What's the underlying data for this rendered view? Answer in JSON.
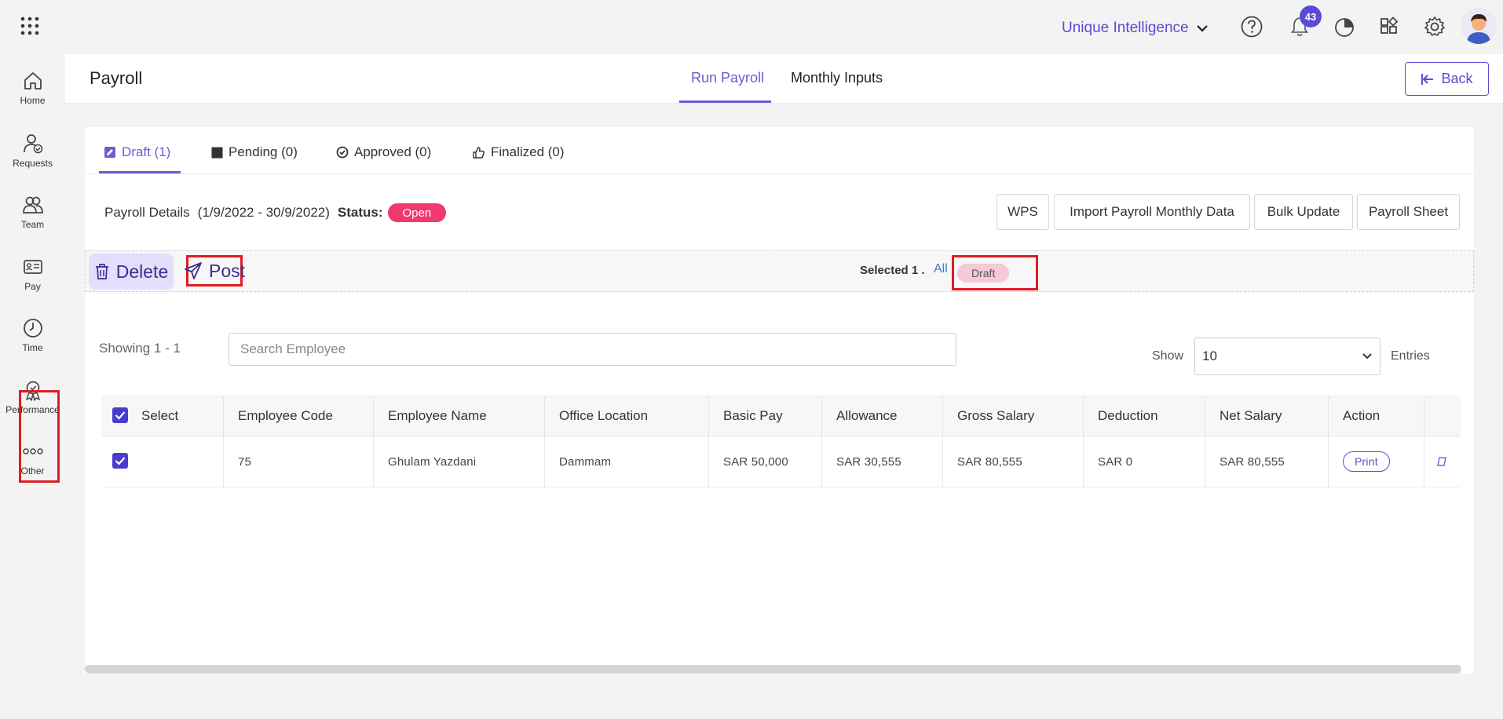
{
  "topbar": {
    "org_name": "Unique Intelligence",
    "notification_count": "43"
  },
  "sidebar": {
    "items": [
      {
        "label": "Home"
      },
      {
        "label": "Requests"
      },
      {
        "label": "Team"
      },
      {
        "label": "Pay"
      },
      {
        "label": "Time"
      },
      {
        "label": "Performance"
      },
      {
        "label": "Other"
      }
    ]
  },
  "header": {
    "title": "Payroll",
    "tabs": [
      {
        "label": "Run Payroll",
        "active": true
      },
      {
        "label": "Monthly Inputs",
        "active": false
      }
    ],
    "back_label": "Back"
  },
  "status_tabs": [
    {
      "label": "Draft (1)",
      "icon": "edit-icon",
      "active": true
    },
    {
      "label": "Pending (0)",
      "icon": "square-icon",
      "active": false
    },
    {
      "label": "Approved (0)",
      "icon": "check-circle-icon",
      "active": false
    },
    {
      "label": "Finalized (0)",
      "icon": "thumbs-up-icon",
      "active": false
    }
  ],
  "details": {
    "label": "Payroll Details",
    "period": "(1/9/2022 - 30/9/2022)",
    "status_label": "Status:",
    "status_value": "Open",
    "status_color": "#f2386c"
  },
  "actions": [
    "WPS",
    "Import Payroll Monthly Data",
    "Bulk Update",
    "Payroll Sheet"
  ],
  "bulk": {
    "delete_label": "Delete",
    "post_label": "Post",
    "selected_text": "Selected 1 .",
    "all_label": "All",
    "draft_label": "Draft"
  },
  "list_controls": {
    "showing": "Showing 1 - 1",
    "search_placeholder": "Search Employee",
    "show_label": "Show",
    "entries_value": "10",
    "entries_label": "Entries"
  },
  "table": {
    "columns": [
      "Select",
      "Employee Code",
      "Employee Name",
      "Office Location",
      "Basic Pay",
      "Allowance",
      "Gross Salary",
      "Deduction",
      "Net Salary",
      "Action",
      ""
    ],
    "rows": [
      {
        "code": "75",
        "name": "Ghulam Yazdani",
        "location": "Dammam",
        "basic": "SAR 50,000",
        "allowance": "SAR 30,555",
        "gross": "SAR 80,555",
        "deduction": "SAR 0",
        "net": "SAR 80,555",
        "action": "Print",
        "checked": true
      }
    ]
  },
  "theme": {
    "accent": "#5a4bd3",
    "highlight_red": "#e01b24"
  }
}
